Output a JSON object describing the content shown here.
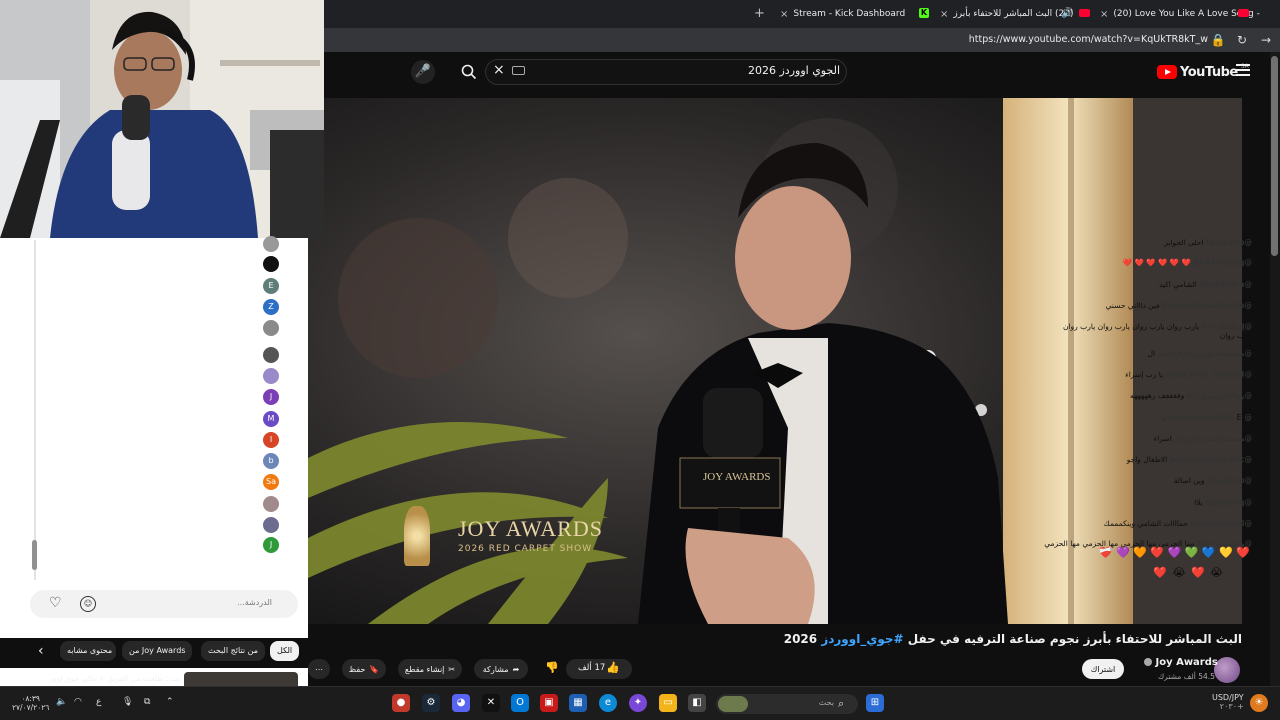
{
  "browser": {
    "tabs": [
      {
        "label": "(20) Love You Like A Love Song -",
        "close": "×",
        "accent": "#ff0033"
      },
      {
        "label": "(20) البث المباشر للاحتفاء بأبرز",
        "close": "×",
        "accent": "#ff0033"
      },
      {
        "label": "Stream - Kick Dashboard",
        "close": "×",
        "accent": "#53fc18"
      }
    ],
    "new_tab": "+",
    "url": "https://www.youtube.com/watch?v=KqUkTR8kT_w"
  },
  "youtube": {
    "logo_text": "YouTube",
    "country_code": "SA",
    "search_query": "الجوي اووردز 2026",
    "clear": "×",
    "video_title_main": "البث المباشر للاحتفاء بأبرز نجوم صناعة الترفيه في حفل",
    "video_title_hashtag": "#جوي_اووردز",
    "video_title_year": "2026",
    "channel_name": "Joy Awards",
    "subscribers": "54.5 ألف مشترك",
    "subscribe_label": "اشتراك",
    "likes": "17 ألف",
    "share_label": "مشاركة",
    "clip_label": "إنشاء مقطع",
    "save_label": "حفظ",
    "overlay_logo": "JOY AWARDS",
    "overlay_sub": "2026 RED CARPET SHOW",
    "mic_brand": "JOY AWARDS"
  },
  "chat": {
    "messages": [
      {
        "user": "@Lana-v7o",
        "text": "احلى الجوايز",
        "avatar": "",
        "color": "#999999"
      },
      {
        "user": "@SARA-s9e2g",
        "text": "❤️ ❤️ ❤️ ❤️ ❤️ ❤️",
        "avatar": "",
        "color": "#111111"
      },
      {
        "user": "@EhabZokra",
        "text": "الشامي اكيد",
        "avatar": "E",
        "color": "#5f7e7a"
      },
      {
        "user": "@ZeinabHamada-o5p",
        "text": "فين داااني حسني",
        "avatar": "Z",
        "color": "#2c6fc4"
      },
      {
        "user": "@إبوالعلي-٧x",
        "text": "يارب روان يارب روان يارب روان يارب روان يارب روان",
        "avatar": "",
        "color": "#8a8a8a"
      },
      {
        "user": "@محمدالشهراني-د٧ح٥س",
        "text": "ال",
        "avatar": "",
        "color": "#555555"
      },
      {
        "user": "@kpop_with_riana13",
        "text": "يا رب إسراء",
        "avatar": "",
        "color": "#9b8ac9"
      },
      {
        "user": "@رهالحربي-خ٥٠١",
        "text": "وففففف رهههههه",
        "avatar": "J",
        "color": "#7b3fb5"
      },
      {
        "user": "@mariammer9361",
        "text": "Er.",
        "avatar": "M",
        "color": "#6a4bc4"
      },
      {
        "user": "@محمداحمد-ز٥ص٥ي",
        "text": "اسراء",
        "avatar": "I",
        "color": "#d64528"
      },
      {
        "user": "@bouzianemrsl-u5c",
        "text": "الاطفال واجو",
        "avatar": "b",
        "color": "#6b86b7"
      },
      {
        "user": "@Sa-jp1bp",
        "text": "وين اصالة",
        "avatar": "Sa",
        "color": "#f07a10"
      },
      {
        "user": "@Egbc-g7q",
        "text": "يلاا",
        "avatar": "",
        "color": "#a08a8a"
      },
      {
        "user": "@starzalshami",
        "text": "حماااات الشامي وينكمممك",
        "avatar": "",
        "color": "#6c6c90"
      },
      {
        "user": "@وجهيسد-ح٥٥",
        "text": "مها الحزمي مها الحزمي مها الحزمي مها الحزمي",
        "avatar": "J",
        "color": "#2e9a3a"
      }
    ],
    "hearts_row": "❤️ 💛 💙 💚 💜 ❤️ 🧡 💜 ❤️‍🩹",
    "hearts_row2": "😭 ❤️ 😭 ❤️",
    "input_placeholder": "الدردشة..."
  },
  "chips": {
    "items": [
      "الكل",
      "من نتائج البحث",
      "من Joy Awards",
      "محتوى مشابه"
    ]
  },
  "suggest": {
    "text": "بث : طلحت من الفريق + مالي جوي اوورد"
  },
  "taskbar": {
    "search_placeholder": "بحث",
    "clock_time": "٠٨:٣٩",
    "clock_date": "٢٧/٠٧/٢٠٢٦",
    "ticker": "USD/JPY",
    "ticker_value": "٢٠٣٠+"
  }
}
